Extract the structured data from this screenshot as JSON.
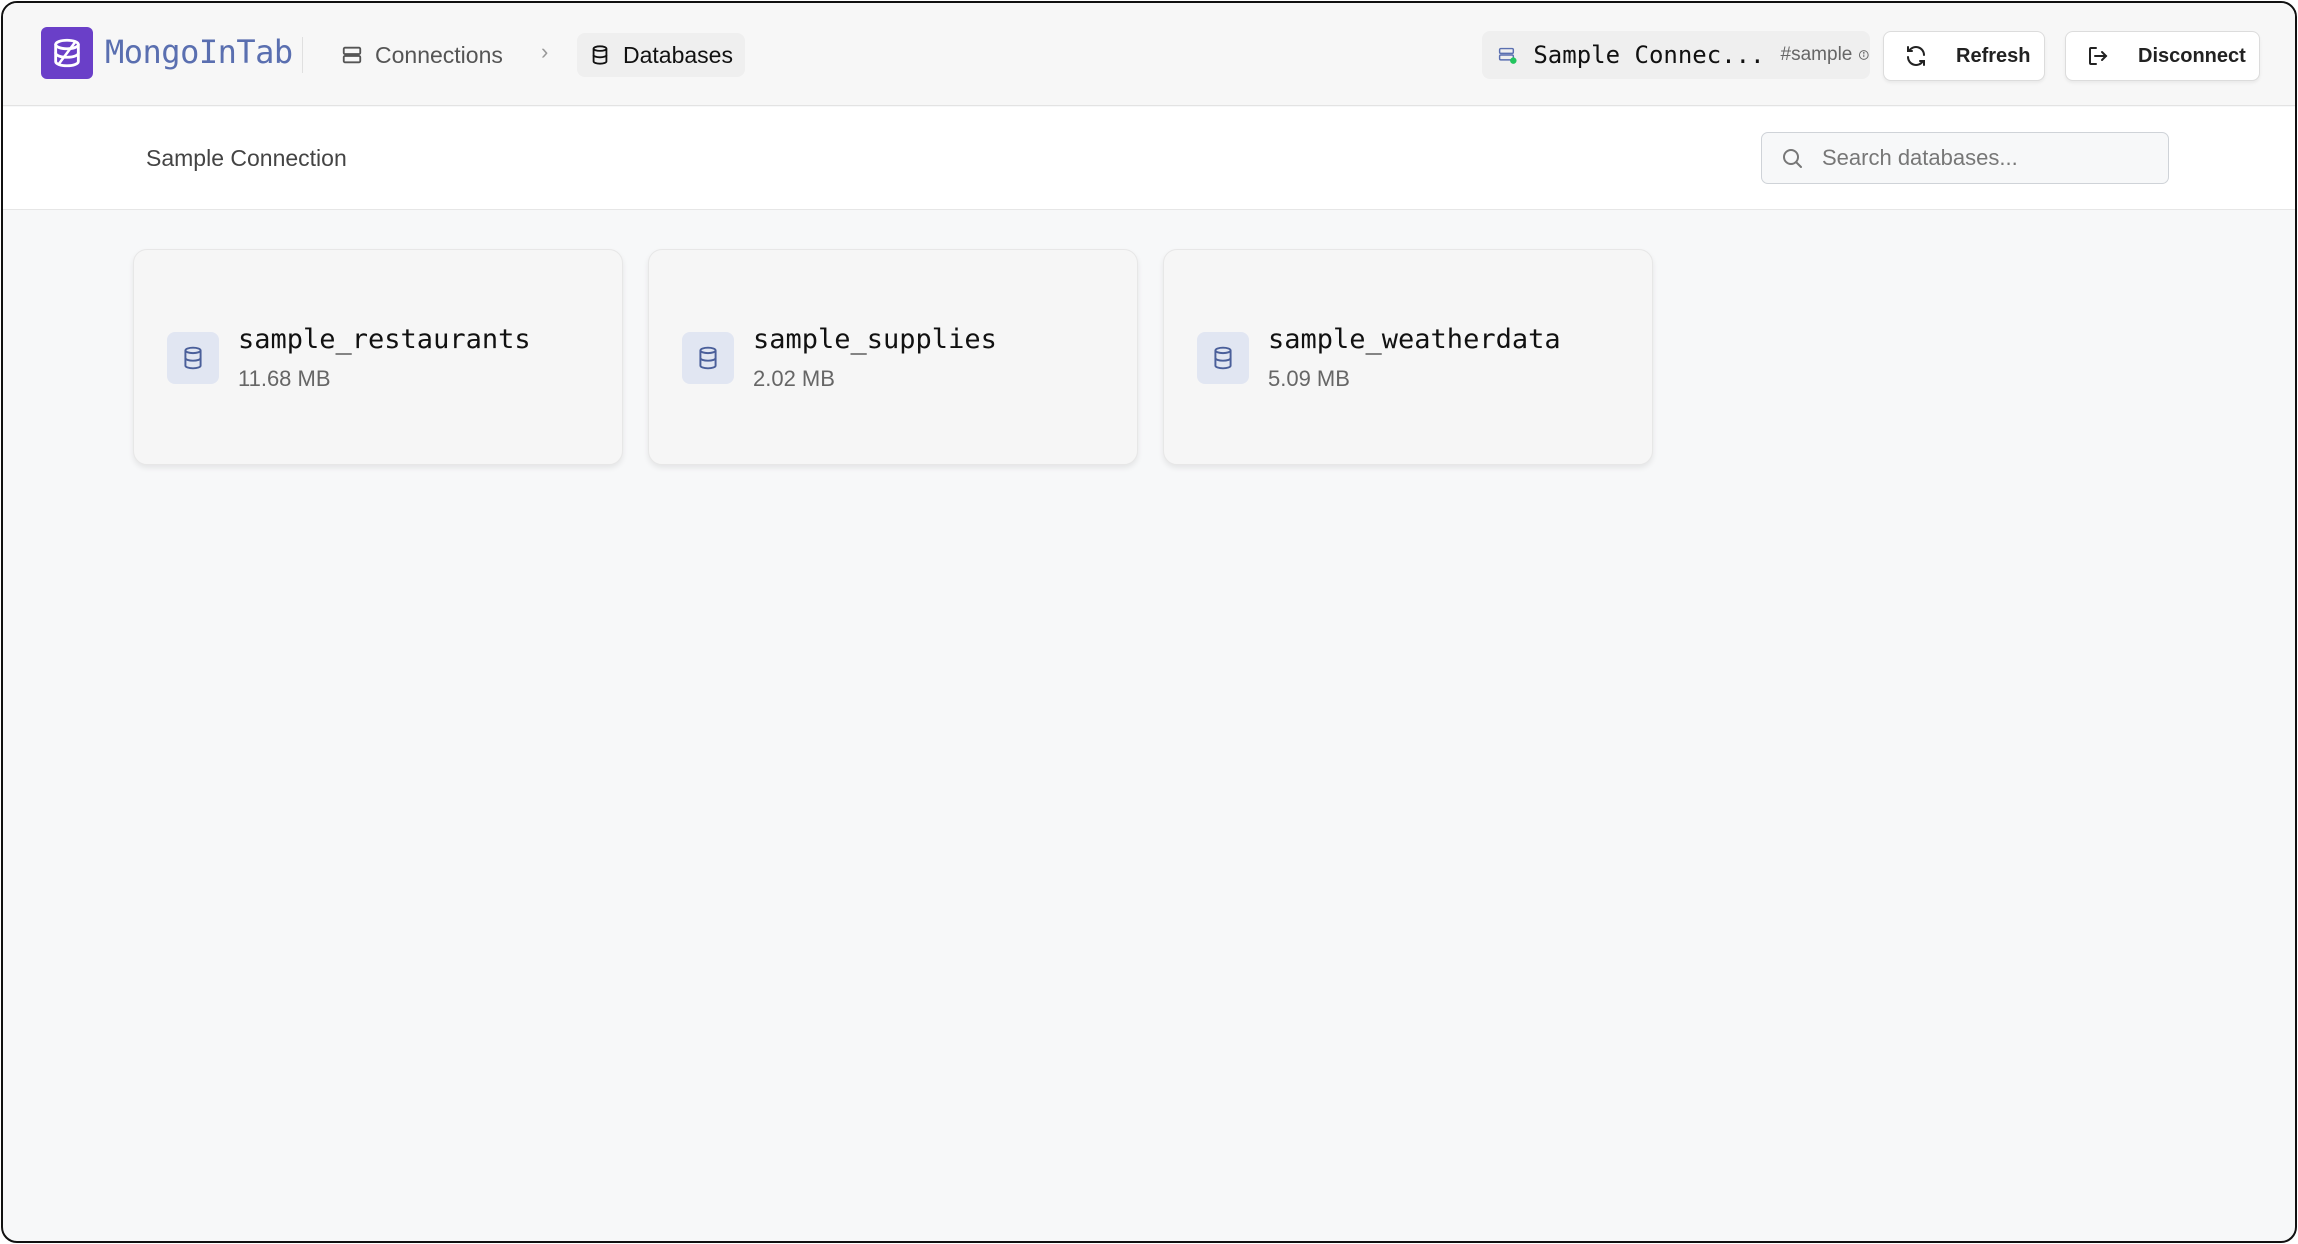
{
  "app": {
    "title": "MongoInTab"
  },
  "breadcrumb": {
    "connections": "Connections",
    "databases": "Databases"
  },
  "connection": {
    "name": "Sample Connec...",
    "tag": "#sample",
    "status_color": "#22c55e",
    "full_name": "Sample Connection"
  },
  "toolbar": {
    "refresh_label": "Refresh",
    "disconnect_label": "Disconnect"
  },
  "search": {
    "placeholder": "Search databases..."
  },
  "databases": [
    {
      "name": "sample_restaurants",
      "size": "11.68 MB"
    },
    {
      "name": "sample_supplies",
      "size": "2.02 MB"
    },
    {
      "name": "sample_weatherdata",
      "size": "5.09 MB"
    }
  ],
  "colors": {
    "brand": "#6a3fc8",
    "title": "#5a6fb0",
    "db_icon": "#4a5f9a"
  },
  "icons": {
    "logo": "database-stack-icon",
    "connections": "server-icon",
    "databases": "database-icon",
    "refresh": "refresh-icon",
    "disconnect": "logout-icon",
    "search": "search-icon",
    "info": "info-icon"
  }
}
